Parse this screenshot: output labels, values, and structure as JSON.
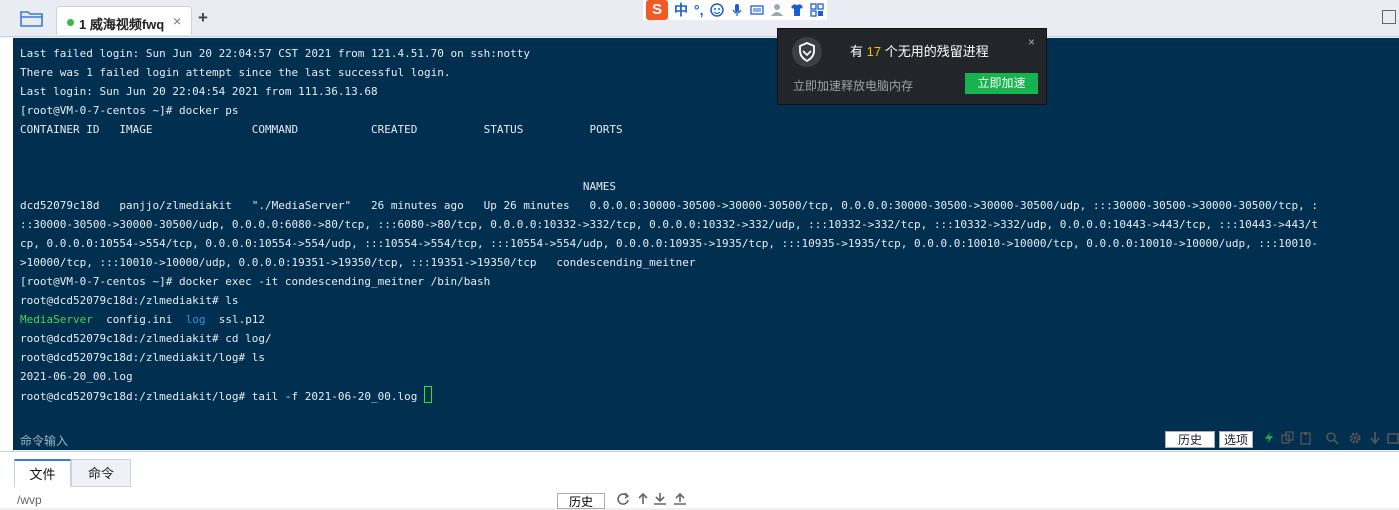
{
  "tabbar": {
    "tab_label": "1 威海视频fwq",
    "close_glyph": "×",
    "new_tab_glyph": "+"
  },
  "ime": {
    "logo": "S",
    "mode": "中"
  },
  "terminal": {
    "lines": [
      [
        {
          "t": "Last failed login: Sun Jun 20 22:04:57 CST 2021 from 121.4.51.70 on ssh:notty"
        }
      ],
      [
        {
          "t": "There was 1 failed login attempt since the last successful login."
        }
      ],
      [
        {
          "t": "Last login: Sun Jun 20 22:04:54 2021 from 111.36.13.68"
        }
      ],
      [
        {
          "t": "[root@VM-0-7-centos ~]# docker ps"
        }
      ],
      [
        {
          "t": "CONTAINER ID   IMAGE               COMMAND           CREATED          STATUS          PORTS"
        }
      ],
      [
        {
          "t": ""
        }
      ],
      [
        {
          "t": ""
        }
      ],
      [
        {
          "t": "                                                                                     NAMES"
        }
      ],
      [
        {
          "t": "dcd52079c18d   panjjo/zlmediakit   \"./MediaServer\"   26 minutes ago   Up 26 minutes   0.0.0.0:30000-30500->30000-30500/tcp, 0.0.0.0:30000-30500->30000-30500/udp, :::30000-30500->30000-30500/tcp, :"
        }
      ],
      [
        {
          "t": "::30000-30500->30000-30500/udp, 0.0.0.0:6080->80/tcp, :::6080->80/tcp, 0.0.0.0:10332->332/tcp, 0.0.0.0:10332->332/udp, :::10332->332/tcp, :::10332->332/udp, 0.0.0.0:10443->443/tcp, :::10443->443/t"
        }
      ],
      [
        {
          "t": "cp, 0.0.0.0:10554->554/tcp, 0.0.0.0:10554->554/udp, :::10554->554/tcp, :::10554->554/udp, 0.0.0.0:10935->1935/tcp, :::10935->1935/tcp, 0.0.0.0:10010->10000/tcp, 0.0.0.0:10010->10000/udp, :::10010-"
        }
      ],
      [
        {
          "t": ">10000/tcp, :::10010->10000/udp, 0.0.0.0:19351->19350/tcp, :::19351->19350/tcp   condescending_meitner"
        }
      ],
      [
        {
          "t": "[root@VM-0-7-centos ~]# docker exec -it condescending_meitner /bin/bash"
        }
      ],
      [
        {
          "t": "root@dcd52079c18d:/zlmediakit# ls"
        }
      ],
      [
        {
          "t": "MediaServer",
          "c": "green"
        },
        {
          "t": "  config.ini  "
        },
        {
          "t": "log",
          "c": "blue"
        },
        {
          "t": "  ssl.p12"
        }
      ],
      [
        {
          "t": "root@dcd52079c18d:/zlmediakit# cd log/"
        }
      ],
      [
        {
          "t": "root@dcd52079c18d:/zlmediakit/log# ls"
        }
      ],
      [
        {
          "t": "2021-06-20_00.log"
        }
      ],
      [
        {
          "t": "root@dcd52079c18d:/zlmediakit/log# tail -f 2021-06-20_00.log "
        },
        {
          "cursor": true
        }
      ]
    ]
  },
  "popup": {
    "title_pre": "有 ",
    "count": "17",
    "title_post": " 个无用的残留进程",
    "subtitle": "立即加速释放电脑内存",
    "button": "立即加速",
    "close_glyph": "×"
  },
  "cmdbar": {
    "label": "命令输入",
    "history": "历史",
    "options": "选项"
  },
  "bottom": {
    "tab_files": "文件",
    "tab_commands": "命令",
    "path": "/wvp",
    "history": "历史"
  },
  "colors": {
    "terminal_bg": "#012f4f",
    "accent_green": "#16b34f",
    "highlight_yellow": "#f3c000"
  }
}
